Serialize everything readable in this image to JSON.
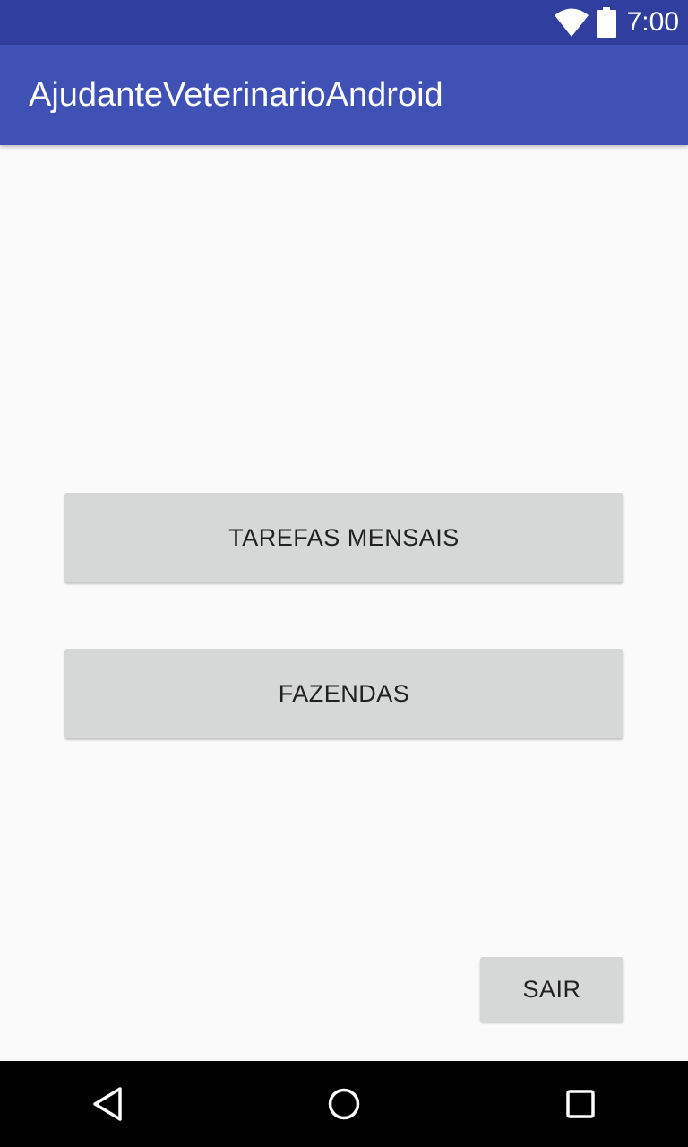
{
  "status_bar": {
    "time": "7:00",
    "icons": [
      "wifi-icon",
      "battery-icon"
    ],
    "background_color": "#303f9f"
  },
  "app_bar": {
    "title": "AjudanteVeterinarioAndroid",
    "background_color": "#3f51b5"
  },
  "main": {
    "buttons": {
      "tarefas_label": "TAREFAS MENSAIS",
      "fazendas_label": "FAZENDAS",
      "sair_label": "SAIR"
    },
    "button_color": "#d6d7d7"
  },
  "nav_bar": {
    "icons": [
      "back-icon",
      "home-icon",
      "recents-icon"
    ]
  }
}
